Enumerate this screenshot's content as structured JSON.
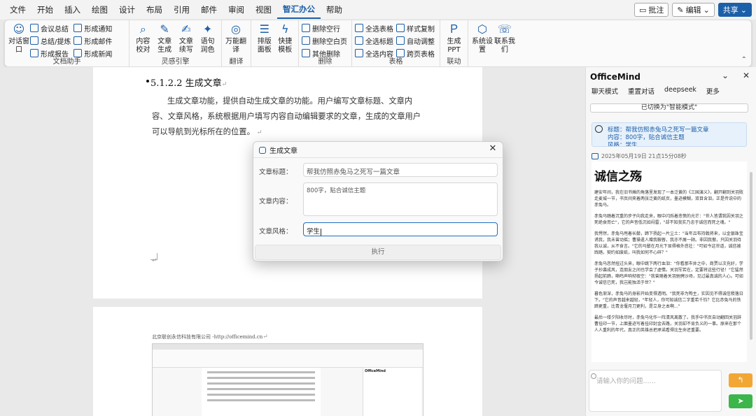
{
  "menu": {
    "items": [
      "文件",
      "开始",
      "插入",
      "绘图",
      "设计",
      "布局",
      "引用",
      "邮件",
      "审阅",
      "视图",
      "智汇办公",
      "帮助"
    ],
    "active": "智汇办公",
    "comment_label": "批注",
    "edit_label": "编辑",
    "share_label": "共享"
  },
  "ribbon": {
    "dialog_window": "对话窗口",
    "meeting_summary": "会议总结",
    "summary_outline": "总结/提炼",
    "form_report": "形成报告",
    "form_notice": "形成通知",
    "form_mail": "形成邮件",
    "form_news": "形成新闻",
    "group_doc_assist": "文档助手",
    "content_check": "内容校对",
    "article_gen": "文章生成",
    "article_continue": "文章续写",
    "sentence_polish": "语句润色",
    "group_inspiration": "灵感引擎",
    "multi_translate": "万能翻译",
    "group_translate": "翻译",
    "layout_panel": "排版面板",
    "quick_template": "快捷模板",
    "del_blank_line": "删除空行",
    "del_blank_page": "删除空白页",
    "other_delete": "其他删除",
    "group_delete": "删除",
    "select_all_tables": "全选表格",
    "select_all_titles": "全选标题",
    "select_all_content": "全选内容",
    "style_copy": "样式复制",
    "auto_adjust": "自动调整",
    "cross_page_tables": "跨页表格",
    "group_table": "表格",
    "gen_ppt": "生成PPT",
    "group_link": "联动",
    "sys_settings": "系统设置",
    "contact_us": "联系我们"
  },
  "doc": {
    "heading": "5.1.2.2 生成文章",
    "paragraph": "生成文章功能，提供自动生成文章的功能。用户编写文章标题、文章内容、文章风格，系统根据用户填写内容自动编辑要求的文章，生成的文章用户可以导航到光标所在的位置。",
    "page2_footer": "北京联创永信科技有限公司 -http://officemind.cn",
    "thumb_panel_title": "OfficeMind"
  },
  "dialog": {
    "title": "生成文章",
    "title_label": "文章标题：",
    "title_value": "帮我仿照赤兔马之死写一篇文章",
    "content_label": "文章内容：",
    "content_value": "800字，贴合诚信主题",
    "style_label": "文章风格：",
    "style_value": "学生",
    "execute_label": "执行"
  },
  "panel": {
    "title": "OfficeMind",
    "tabs": [
      "聊天模式",
      "重置对话",
      "deepseek",
      "更多"
    ],
    "switch_notice": "已切换为\"智能模式\"",
    "q_title": "标题：帮我仿照赤兔马之死写一篇文章",
    "q_content": "内容：800字，贴合诚信主题",
    "q_style": "风格：学生",
    "timestamp": "2025年05月19日 21点15分08秒",
    "article_title": "诚信之殇",
    "article_paragraphs": [
      "建安年间，我在旧书摊的角落里发现了一本泛黄的《三国演义》，翻开翻到关羽败走麦城一节，书页间夹着两张泛黄的纸页，墨迹模糊，双目含泪，正是传说中的赤兔马。",
      "赤兔马踏着沉重的步子向我走来，眼中闪烁着悲愤的光芒：\"世人皆谓我因关羽之死绝食而亡\"，它的声音低沉如闷雷，\"却不知我实乃忠于诚信而死之魂。\"",
      "我愕然，赤兔马甩着长鬃，蹄下扬起一片尘土：\"当年吕布持戟将来，以金银珠宝诱我，我未曾动摇；曹操遣人赠我鞍辔，我亦不屑一顾。非因我傲，只因关羽待我以诚，从不食言。\"它的马鬃在月光下显得格外悲壮：\"可如今这世道，诚信被践踏，契约如废纸，叫我如何不心碎？\"",
      "赤兔马忽然扭过头来，眼中跳下两行血泪：\"你看那市井之中，商贾以次充好，学子抄袭成风，连朋友之间也学会了虚情。关羽军若在，定要将这些行径！\"它猛然扬起前蹄，嘶鸣声响彻夜空：\"我曾随着关羽驰骋沙场，见过最真诚的人心。可如今诚信已死，我岂能独活于世？\"",
      "暮色渐深，赤兔马的身影开始变得透明。\"我死非为殉主，实因见不得诚信陨落日下。\"它的声音越来越轻，\"年轻人，你可知诚信二字重若千钧？它比赤兔马的铁蹄更重，比青龙偃月刀更利，是立身之本啊...\"",
      "最后一缕夕阳收尽时，赤兔马化作一阵清风离散了。我手中书页自动翻回关羽辞曹挂印一节，上面墨迹写着挂印封金去路，关羽却不肯负义的一事。原来在那个人人重利的年代，真正的英雄总把承诺看得比生命还重要。"
    ],
    "input_placeholder": "请输入你的问题......"
  },
  "colors": {
    "accent": "#1b5fa8",
    "send_orange": "#f2a735",
    "send_green": "#3cb54a"
  }
}
